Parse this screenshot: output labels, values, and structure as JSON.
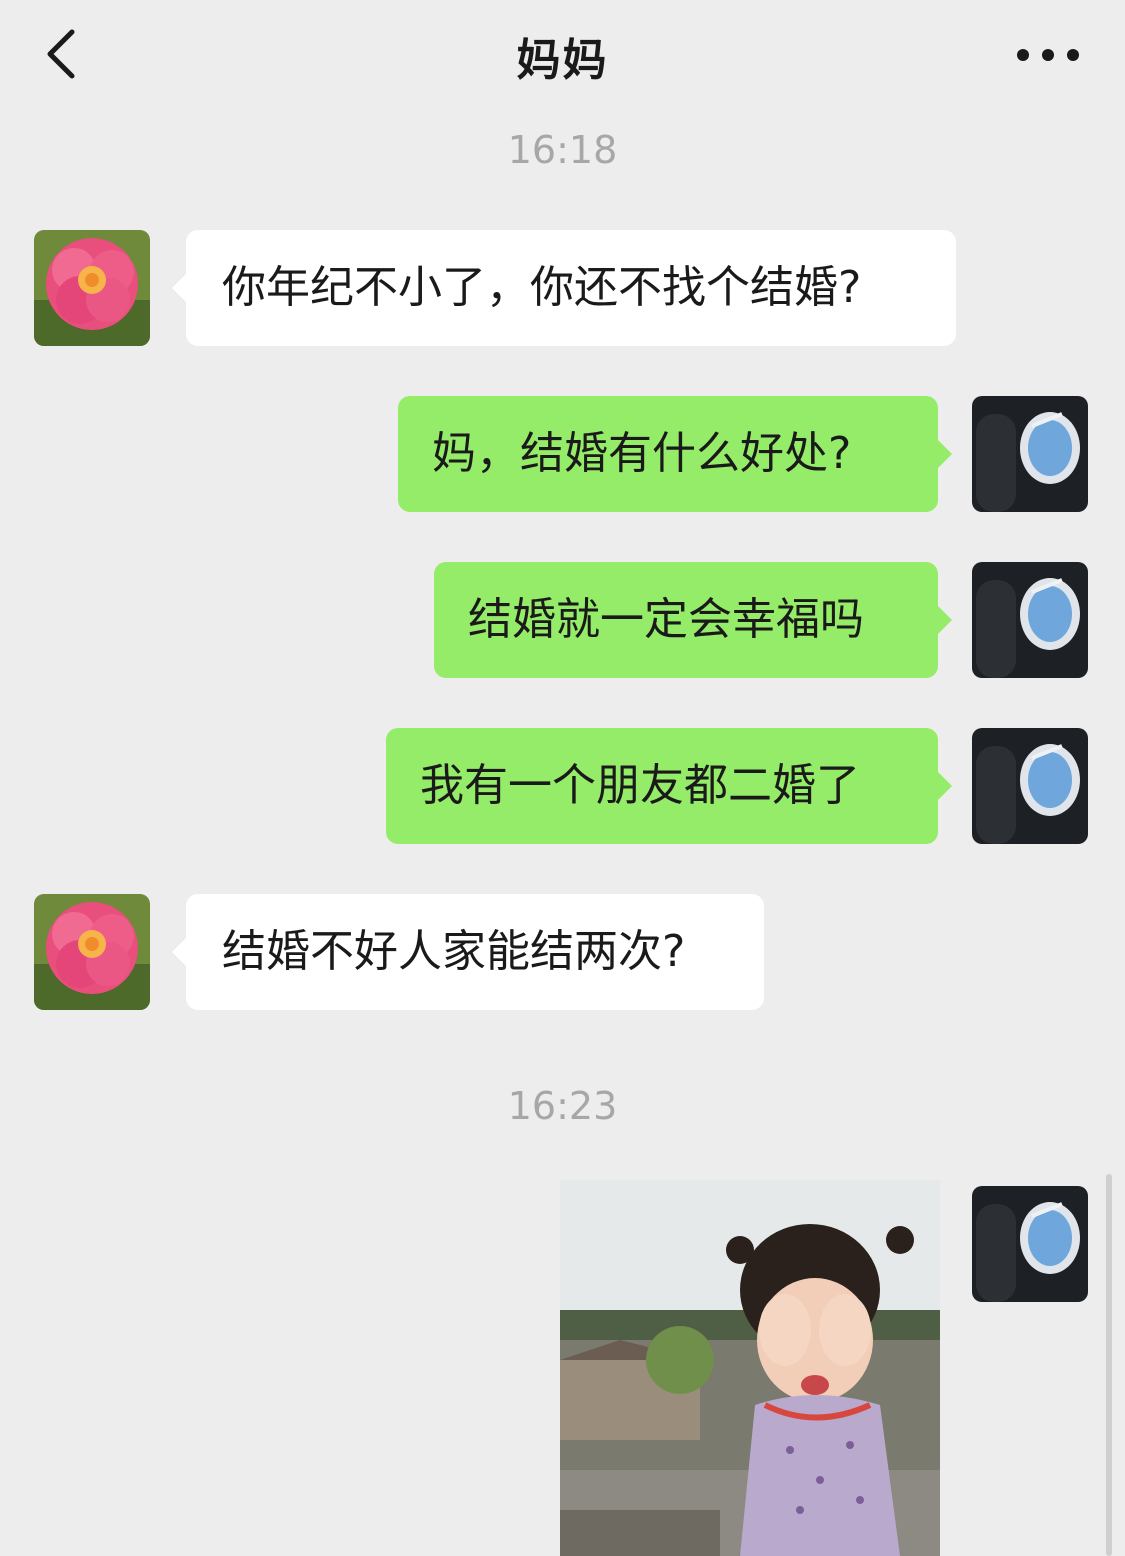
{
  "header": {
    "title": "妈妈",
    "back_icon": "chevron-left-icon",
    "more_icon": "more-dots-icon"
  },
  "timestamps": [
    "16:18",
    "16:23"
  ],
  "messages": [
    {
      "sender": "mom",
      "text": "你年纪不小了，你还不找个结婚?"
    },
    {
      "sender": "me",
      "text": "妈，结婚有什么好处?"
    },
    {
      "sender": "me",
      "text": "结婚就一定会幸福吗"
    },
    {
      "sender": "me",
      "text": "我有一个朋友都二婚了"
    },
    {
      "sender": "mom",
      "text": "结婚不好人家能结两次?"
    },
    {
      "sender": "me",
      "type": "image",
      "description_icon": "crying-child-photo"
    }
  ],
  "colors": {
    "background": "#ededed",
    "incoming_bubble": "#ffffff",
    "outgoing_bubble": "#95ec69",
    "timestamp": "#a7a7a7"
  }
}
